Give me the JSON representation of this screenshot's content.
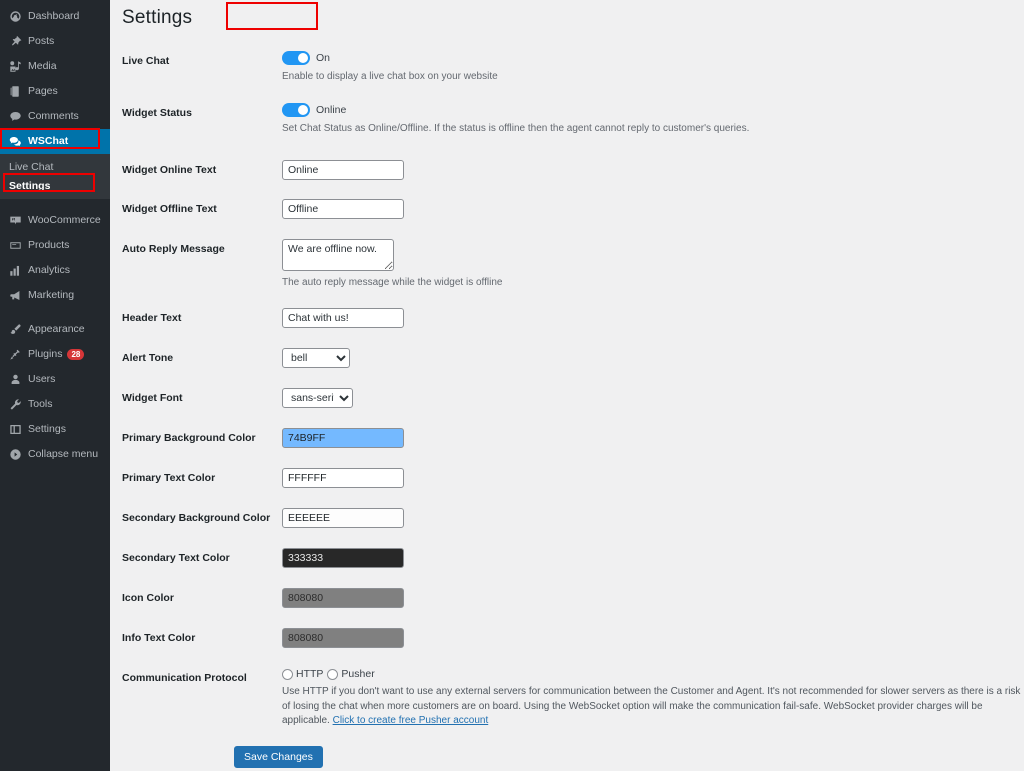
{
  "sidebar": {
    "items": [
      {
        "label": "Dashboard",
        "icon": "dashboard-icon",
        "active": false
      },
      {
        "label": "Posts",
        "icon": "pin-icon",
        "active": false
      },
      {
        "label": "Media",
        "icon": "media-icon",
        "active": false
      },
      {
        "label": "Pages",
        "icon": "pages-icon",
        "active": false
      },
      {
        "label": "Comments",
        "icon": "comment-icon",
        "active": false
      },
      {
        "label": "WSChat",
        "icon": "wschat-icon",
        "active": true
      },
      {
        "label": "WooCommerce",
        "icon": "woocommerce-icon",
        "active": false
      },
      {
        "label": "Products",
        "icon": "products-icon",
        "active": false
      },
      {
        "label": "Analytics",
        "icon": "analytics-icon",
        "active": false
      },
      {
        "label": "Marketing",
        "icon": "megaphone-icon",
        "active": false
      },
      {
        "label": "Appearance",
        "icon": "brush-icon",
        "active": false
      },
      {
        "label": "Plugins",
        "icon": "plugin-icon",
        "active": false,
        "badge": "28"
      },
      {
        "label": "Users",
        "icon": "user-icon",
        "active": false
      },
      {
        "label": "Tools",
        "icon": "wrench-icon",
        "active": false
      },
      {
        "label": "Settings",
        "icon": "settings-icon",
        "active": false
      },
      {
        "label": "Collapse menu",
        "icon": "collapse-icon",
        "active": false
      }
    ],
    "submenu": [
      {
        "label": "Live Chat",
        "current": false
      },
      {
        "label": "Settings",
        "current": true
      }
    ],
    "plugins_badge": "28",
    "active_color": "#0073aa",
    "background_color": "#23282d"
  },
  "page": {
    "title": "Settings",
    "annotation_color": "#ee0000"
  },
  "settings": {
    "live_chat": {
      "label": "Live Chat",
      "toggle_state": "On",
      "description": "Enable to display a live chat box on your website"
    },
    "widget_status": {
      "label": "Widget Status",
      "toggle_state": "Online",
      "description": "Set Chat Status as Online/Offline. If the status is offline then the agent cannot reply to customer's queries."
    },
    "widget_online_text": {
      "label": "Widget Online Text",
      "value": "Online"
    },
    "widget_offline_text": {
      "label": "Widget Offline Text",
      "value": "Offline"
    },
    "auto_reply_message": {
      "label": "Auto Reply Message",
      "value": "We are offline now.",
      "description": "The auto reply message while the widget is offline"
    },
    "header_text": {
      "label": "Header Text",
      "value": "Chat with us!"
    },
    "alert_tone": {
      "label": "Alert Tone",
      "value": "bell",
      "options": [
        "bell"
      ]
    },
    "widget_font": {
      "label": "Widget Font",
      "value": "sans-serif",
      "options": [
        "sans-serif"
      ]
    },
    "primary_background_color": {
      "label": "Primary Background Color",
      "value": "74B9FF",
      "swatch": "#74B9FF",
      "text_color": "#1d2327"
    },
    "primary_text_color": {
      "label": "Primary Text Color",
      "value": "FFFFFF",
      "swatch": "#FFFFFF",
      "text_color": "#1d2327"
    },
    "secondary_background_color": {
      "label": "Secondary Background Color",
      "value": "EEEEEE",
      "swatch": "#FDFDFD",
      "text_color": "#1d2327"
    },
    "secondary_text_color": {
      "label": "Secondary Text Color",
      "value": "333333",
      "swatch": "#282828",
      "text_color": "#e8e8e8"
    },
    "icon_color": {
      "label": "Icon Color",
      "value": "808080",
      "swatch": "#808080",
      "text_color": "#2c2c2c"
    },
    "info_text_color": {
      "label": "Info Text Color",
      "value": "808080",
      "swatch": "#808080",
      "text_color": "#2c2c2c"
    },
    "communication_protocol": {
      "label": "Communication Protocol",
      "options": [
        {
          "label": "HTTP",
          "selected": false
        },
        {
          "label": "Pusher",
          "selected": false
        }
      ],
      "description_part1": "Use HTTP if you don't want to use any external servers for communication between the Customer and Agent. It's not recommended for slower servers as there is a risk of losing the chat when more customers are on board. Using the WebSocket option will make the communication fail-safe. WebSocket provider charges will be applicable. ",
      "link_text": "Click to create free Pusher account"
    },
    "save_button": "Save Changes"
  }
}
